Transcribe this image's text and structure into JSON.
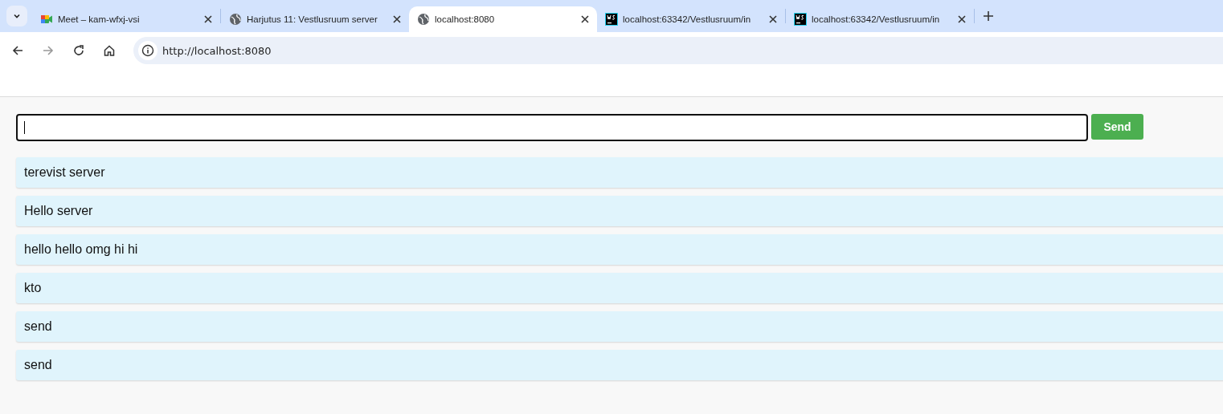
{
  "tabs": [
    {
      "kind": "meet",
      "title": "Meet – kam-wfxj-vsi",
      "selected": false
    },
    {
      "kind": "globe",
      "title": "Harjutus 11: Vestlusruum server",
      "selected": false
    },
    {
      "kind": "globe",
      "title": "localhost:8080",
      "selected": true
    },
    {
      "kind": "ws",
      "title": "localhost:63342/Vestlusruum/in",
      "selected": false
    },
    {
      "kind": "ws",
      "title": "localhost:63342/Vestlusruum/in",
      "selected": false
    }
  ],
  "address_bar": {
    "url": "http://localhost:8080"
  },
  "page": {
    "send_button": "Send",
    "messages": [
      {
        "text": "terevist server"
      },
      {
        "text": "Hello server"
      },
      {
        "text": "hello hello omg hi hi"
      },
      {
        "text": "kto"
      },
      {
        "text": "send"
      },
      {
        "text": "send"
      }
    ]
  }
}
